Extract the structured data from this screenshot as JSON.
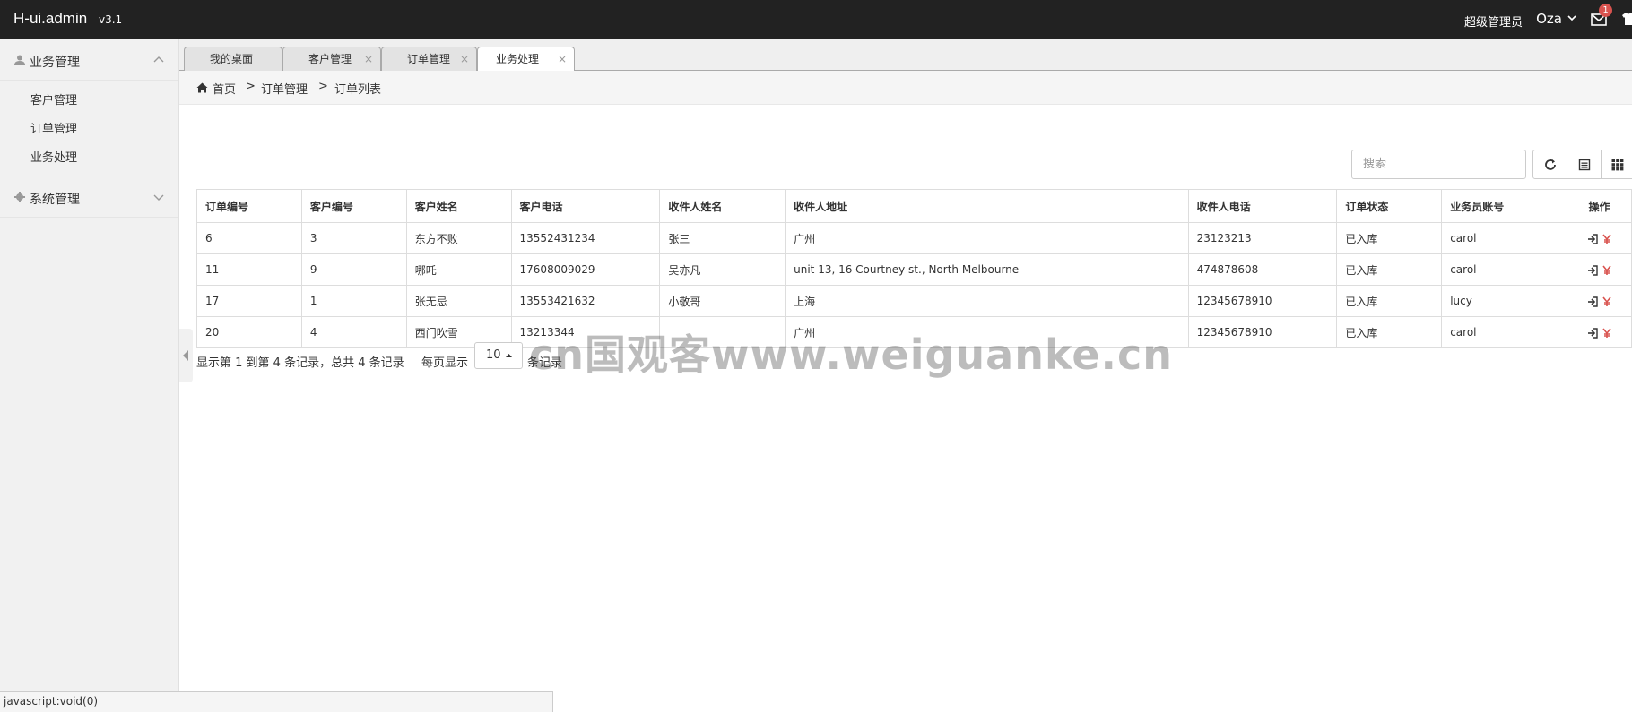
{
  "header": {
    "brand": "H-ui.admin",
    "version": "v3.1",
    "role": "超级管理员",
    "user": "Oza",
    "mail_count": "1",
    "icons": [
      "chevron-down-icon",
      "mail-icon",
      "shirt-icon"
    ]
  },
  "sidebar": {
    "groups": [
      {
        "label": "业务管理",
        "icon": "user-icon",
        "expanded": true,
        "items": [
          "客户管理",
          "订单管理",
          "业务处理"
        ]
      },
      {
        "label": "系统管理",
        "icon": "gear-icon",
        "expanded": false,
        "items": []
      }
    ]
  },
  "tabs": [
    {
      "label": "我的桌面",
      "closable": false
    },
    {
      "label": "客户管理",
      "closable": true,
      "close": "×"
    },
    {
      "label": "订单管理",
      "closable": true,
      "close": "×"
    },
    {
      "label": "业务处理",
      "closable": true,
      "close": "×",
      "active": true
    }
  ],
  "breadcrumb": {
    "home": "首页",
    "sep": ">",
    "level1": "订单管理",
    "level2": "订单列表"
  },
  "search": {
    "placeholder": "搜索"
  },
  "table": {
    "columns": [
      "订单编号",
      "客户编号",
      "客户姓名",
      "客户电话",
      "收件人姓名",
      "收件人地址",
      "收件人电话",
      "订单状态",
      "业务员账号",
      "操作"
    ],
    "rows": [
      [
        "6",
        "3",
        "东方不败",
        "13552431234",
        "张三",
        "广州",
        "23123213",
        "已入库",
        "carol"
      ],
      [
        "11",
        "9",
        "哪吒",
        "17608009029",
        "吴亦凡",
        "unit 13, 16 Courtney st., North Melbourne",
        "474878608",
        "已入库",
        "carol"
      ],
      [
        "17",
        "1",
        "张无忌",
        "13553421632",
        "小敬哥",
        "上海",
        "12345678910",
        "已入库",
        "lucy"
      ],
      [
        "20",
        "4",
        "西门吹雪",
        "13213344",
        "",
        "广州",
        "12345678910",
        "已入库",
        "carol"
      ]
    ]
  },
  "pager": {
    "summary": "显示第 1 到第 4 条记录，总共 4 条记录",
    "per_page_label": "每页显示",
    "per_page": "10",
    "suffix": "条记录"
  },
  "watermark": "cn国观客www.weiguanke.cn",
  "status_bar": "javascript:void(0)",
  "colors": {
    "header_bg": "#222222",
    "sidebar_bg": "#f1f1f1",
    "action_red": "#d9534f"
  }
}
